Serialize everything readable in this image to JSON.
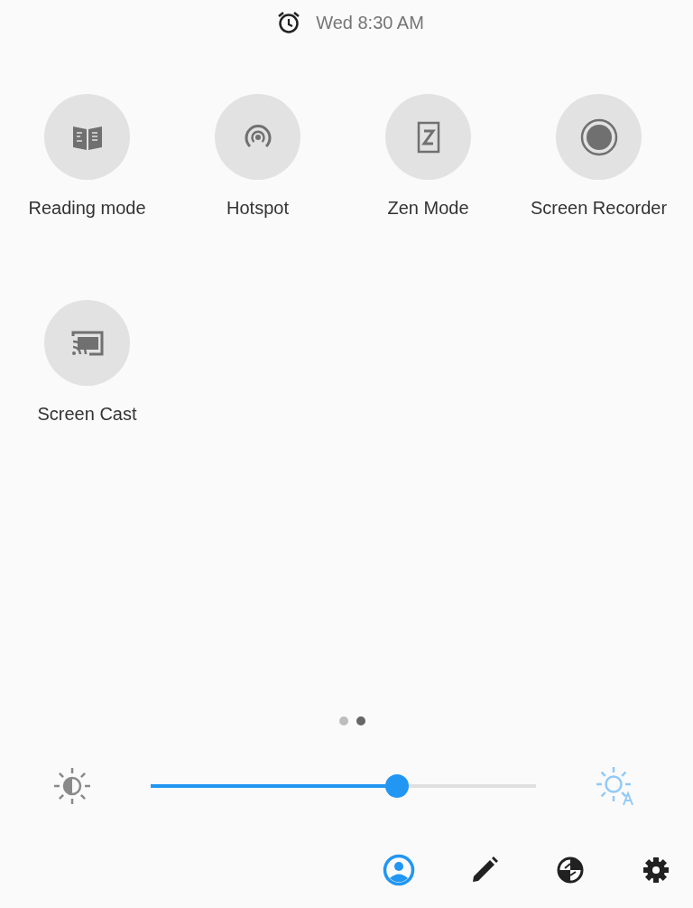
{
  "status": {
    "time": "Wed 8:30 AM"
  },
  "tiles": [
    {
      "kind": "reading",
      "label": "Reading mode"
    },
    {
      "kind": "hotspot",
      "label": "Hotspot"
    },
    {
      "kind": "zen",
      "label": "Zen Mode"
    },
    {
      "kind": "record",
      "label": "Screen Recorder"
    },
    {
      "kind": "cast",
      "label": "Screen Cast"
    }
  ],
  "pages": [
    {
      "selected": false
    },
    {
      "selected": true
    }
  ],
  "brightness": {
    "level": 0.64
  },
  "actions": [
    {
      "kind": "user",
      "selected": true
    },
    {
      "kind": "edit",
      "selected": false
    },
    {
      "kind": "datasaver",
      "selected": false
    },
    {
      "kind": "settings",
      "selected": false
    }
  ]
}
